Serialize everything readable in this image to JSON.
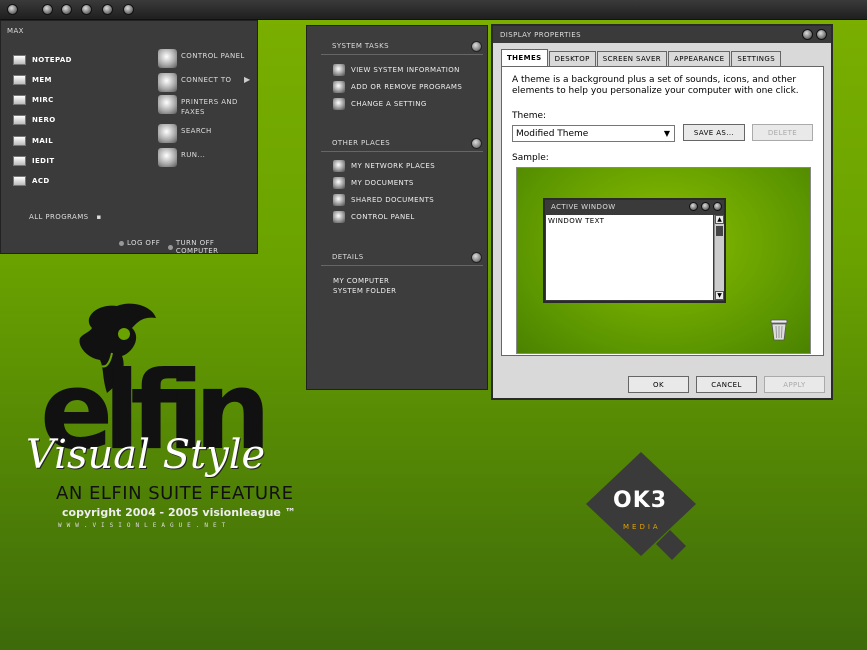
{
  "start_menu": {
    "user": "MAX",
    "pinned": [
      {
        "label": "NOTEPAD"
      },
      {
        "label": "MEM"
      },
      {
        "label": "MIRC"
      },
      {
        "label": "NERO"
      },
      {
        "label": "MAIL"
      },
      {
        "label": "IEDIT"
      },
      {
        "label": "ACD"
      }
    ],
    "right": [
      {
        "label": "CONTROL PANEL",
        "icon": "control-panel-icon"
      },
      {
        "label": "CONNECT TO",
        "icon": "network-icon",
        "submenu": "▶"
      },
      {
        "label": "PRINTERS AND",
        "label2": "FAXES",
        "icon": "printer-icon"
      },
      {
        "label": "SEARCH",
        "icon": "search-icon"
      },
      {
        "label": "RUN...",
        "icon": "run-icon"
      }
    ],
    "all_programs": "ALL PROGRAMS",
    "all_programs_arrow": "▪",
    "log_off": "LOG OFF",
    "turn_off": "TURN OFF COMPUTER"
  },
  "task_panel": {
    "system_tasks": {
      "title": "SYSTEM TASKS",
      "items": [
        "VIEW SYSTEM INFORMATION",
        "ADD OR REMOVE PROGRAMS",
        "CHANGE A SETTING"
      ]
    },
    "other_places": {
      "title": "OTHER PLACES",
      "items": [
        "MY NETWORK PLACES",
        "MY DOCUMENTS",
        "SHARED DOCUMENTS",
        "CONTROL PANEL"
      ]
    },
    "details": {
      "title": "DETAILS",
      "line1": "MY COMPUTER",
      "line2": "SYSTEM FOLDER"
    }
  },
  "dialog": {
    "title": "DISPLAY PROPERTIES",
    "tabs": [
      "THEMES",
      "DESKTOP",
      "SCREEN SAVER",
      "APPEARANCE",
      "SETTINGS"
    ],
    "active_tab": "THEMES",
    "description": "A theme is a background plus a set of sounds, icons, and other elements to help you personalize your computer with one click.",
    "theme_label": "Theme:",
    "theme_value": "Modified Theme",
    "save_as": "SAVE AS...",
    "delete": "DELETE",
    "sample_label": "Sample:",
    "sample_window_title": "ACTIVE WINDOW",
    "sample_window_text": "WINDOW TEXT",
    "ok": "OK",
    "cancel": "CANCEL",
    "apply": "APPLY"
  },
  "branding": {
    "elfin": "elfin",
    "visual_style": "Visual Style",
    "suite": "AN ELFIN SUITE FEATURE",
    "copyright": "copyright 2004 - 2005 visionleague ™",
    "website": "WWW.VISIONLEAGUE.NET",
    "ok3": "OK3",
    "ok3_sub": "MEDIA"
  },
  "colors": {
    "desktop_green": "#6aa200",
    "panel_dark": "#3b3b3b",
    "dialog_gray": "#d9d9d9"
  }
}
